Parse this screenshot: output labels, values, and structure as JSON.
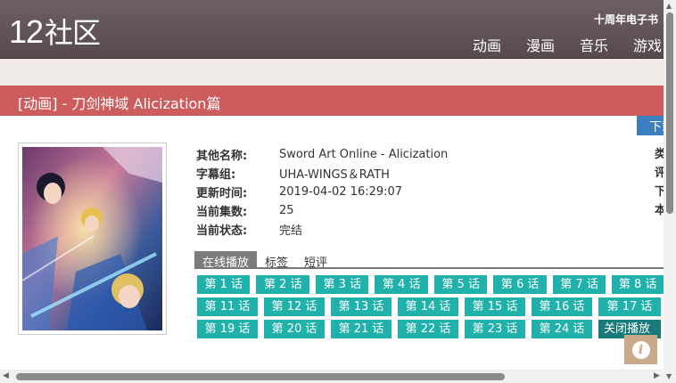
{
  "header": {
    "logo_num": "12",
    "logo_text": "社区",
    "anniversary": "十周年电子书",
    "nav": [
      "动画",
      "漫画",
      "音乐",
      "游戏"
    ]
  },
  "title": "[动画] - 刀剑神域 Alicization篇",
  "download_label": "下载",
  "info": [
    {
      "label": "其他名称:",
      "value": "Sword Art Online - Alicization"
    },
    {
      "label": "字幕组:",
      "value": "UHA-WINGS＆RATH"
    },
    {
      "label": "更新时间:",
      "value": "2019-04-02 16:29:07"
    },
    {
      "label": "当前集数:",
      "value": "25"
    },
    {
      "label": "当前状态:",
      "value": "完结"
    }
  ],
  "right_col": [
    "类",
    "评",
    "下",
    "本"
  ],
  "tabs": [
    "在线播放",
    "标签",
    "短评"
  ],
  "episodes": [
    [
      "第 1 话",
      "第 2 话",
      "第 3 话",
      "第 4 话",
      "第 5 话",
      "第 6 话",
      "第 7 话",
      "第 8 话"
    ],
    [
      "第 11 话",
      "第 12 话",
      "第 13 话",
      "第 14 话",
      "第 15 话",
      "第 16 话",
      "第 17 话"
    ],
    [
      "第 19 话",
      "第 20 话",
      "第 21 话",
      "第 22 话",
      "第 23 话",
      "第 24 话"
    ]
  ],
  "close_player": "关闭播放",
  "colors": {
    "header": "#574a4c",
    "title_bar": "#cd5c5c",
    "episode": "#20b2aa",
    "close": "#1a7a7a",
    "download": "#3b7fbf"
  }
}
